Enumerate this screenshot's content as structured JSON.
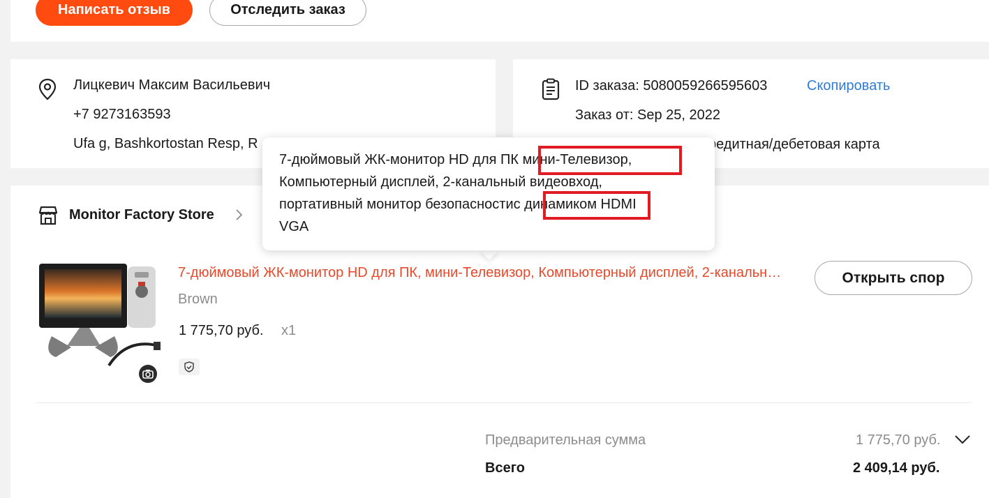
{
  "top_actions": {
    "write_review": "Написать отзыв",
    "track_order": "Отследить заказ"
  },
  "address": {
    "name": "Лицкевич Максим Васильевич",
    "phone": "+7 9273163593",
    "location": "Ufa g, Bashkortostan Resp, R"
  },
  "order": {
    "id_label": "ID заказа: 5080059266595603",
    "copy_link": "Скопировать",
    "date_label": "Заказ от: Sep 25, 2022",
    "payment_visible": "редитная/дебетовая карта"
  },
  "store": {
    "name": "Monitor Factory Store"
  },
  "product": {
    "title": "7-дюймовый ЖК-монитор HD для ПК, мини-Телевизор, Компьютерный дисплей, 2-канальный видеовход, портативный монитор безопасности с динамиком HDMI VGA",
    "variant": "Brown",
    "price": "1 775,70 руб.",
    "quantity": "x1",
    "dispute_button": "Открыть спор"
  },
  "tooltip": {
    "line1_pre": "7-дюймовый ЖК-монитор HD для ПК",
    "line1_highlight": " мини-Телевизор,",
    "line2": "Компьютерный дисплей, 2-канальный видеовход,",
    "line3_pre": "портативный монитор безопасности",
    "line3_highlight": "с динамиком ",
    "line3_post": "HDMI",
    "line4": "VGA"
  },
  "summary": {
    "subtotal_label": "Предварительная сумма",
    "subtotal_value": "1 775,70 руб.",
    "total_label": "Всего",
    "total_value": "2 409,14 руб."
  },
  "colors": {
    "primary": "#ff4a10",
    "link": "#2e7bd6",
    "product_title": "#e8492b",
    "highlight_box": "#e01b24"
  }
}
